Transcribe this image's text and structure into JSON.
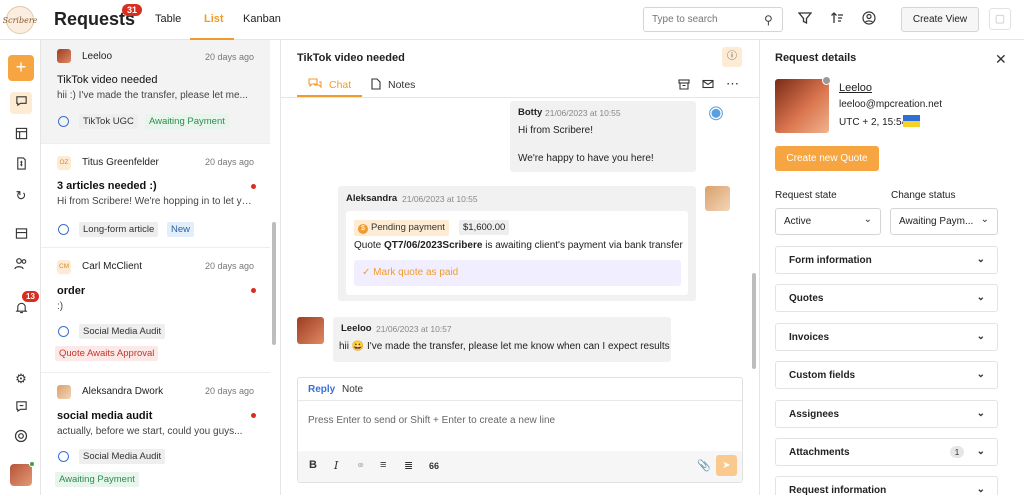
{
  "header": {
    "logo_text": "Scribere",
    "title": "Requests",
    "count": "31",
    "tabs": {
      "table": "Table",
      "list": "List",
      "kanban": "Kanban"
    },
    "search_placeholder": "Type to search",
    "create_view": "Create View"
  },
  "nav": {
    "notif_count": "13"
  },
  "conversations": [
    {
      "name": "Leeloo",
      "date": "20 days ago",
      "title": "TikTok video needed",
      "preview": "hii :) I've made the transfer, please let me...",
      "tags": [
        "TikTok UGC",
        "Awaiting Payment"
      ]
    },
    {
      "name": "Titus Greenfelder",
      "initials": "OZ",
      "date": "20 days ago",
      "title": "3 articles needed :)",
      "preview": "Hi from Scribere! We're hopping in to let you...",
      "tags": [
        "Long-form article",
        "New"
      ]
    },
    {
      "name": "Carl McClient",
      "initials": "CM",
      "date": "20 days ago",
      "title": "order",
      "preview": ":)",
      "tags": [
        "Social Media Audit",
        "Quote Awaits Approval"
      ]
    },
    {
      "name": "Aleksandra Dwork",
      "date": "20 days ago",
      "title": "social media audit",
      "preview": "actually, before we start, could you guys...",
      "tags": [
        "Social Media Audit",
        "Awaiting Payment"
      ]
    }
  ],
  "chat": {
    "title": "TikTok video needed",
    "tabs": {
      "chat": "Chat",
      "notes": "Notes"
    },
    "messages": {
      "botty": {
        "name": "Botty",
        "time": "21/06/2023 at 10:55",
        "line1": "Hi from Scribere!",
        "line2": "We're happy to have you here!"
      },
      "aleksandra": {
        "name": "Aleksandra",
        "time": "21/06/2023 at 10:55",
        "pending": "Pending payment",
        "amount": "$1,600.00",
        "quote_prefix": "Quote ",
        "quote_id": "QT7/06/2023Scribere",
        "quote_suffix": " is awaiting client's payment via bank transfer",
        "mark_paid": "Mark quote as paid"
      },
      "leeloo": {
        "name": "Leeloo",
        "time": "21/06/2023 at 10:57",
        "text_pre": "hii ",
        "emoji": "😀",
        "text_post": " I've made the transfer, please let me know when can I expect results"
      }
    },
    "composer": {
      "reply": "Reply",
      "note": "Note",
      "placeholder": "Press Enter to send or Shift + Enter to create a new line",
      "quote_icon": "66"
    }
  },
  "details": {
    "title": "Request details",
    "name": "Leeloo",
    "email": "leeloo@mpcreation.net",
    "tz": "UTC + 2, 15:54",
    "create_quote": "Create new Quote",
    "request_state_label": "Request state",
    "request_state": "Active",
    "change_status_label": "Change status",
    "change_status": "Awaiting Paym...",
    "accordions": [
      "Form information",
      "Quotes",
      "Invoices",
      "Custom fields",
      "Assignees",
      "Attachments",
      "Request information"
    ],
    "attachments_count": "1"
  },
  "colors": {
    "accent": "#f29b2d",
    "button": "#f7a541",
    "link": "#3b6fd6"
  }
}
